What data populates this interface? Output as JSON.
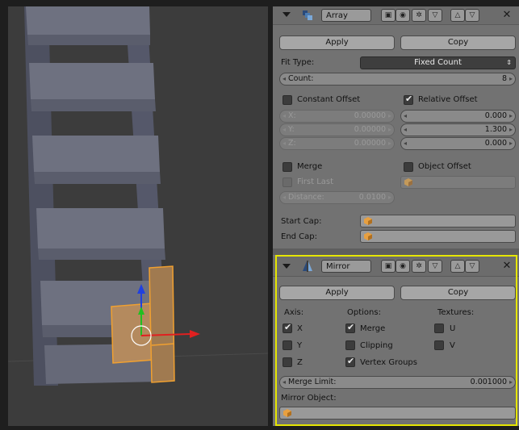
{
  "array": {
    "name": "Array",
    "apply_label": "Apply",
    "copy_label": "Copy",
    "fit_type_label": "Fit Type:",
    "fit_type_value": "Fixed Count",
    "count_label": "Count:",
    "count_value": "8",
    "constant_offset_label": "Constant Offset",
    "constant_offset_checked": false,
    "relative_offset_label": "Relative Offset",
    "relative_offset_checked": true,
    "constant": [
      {
        "label": "X:",
        "value": "0.00000"
      },
      {
        "label": "Y:",
        "value": "0.00000"
      },
      {
        "label": "Z:",
        "value": "0.00000"
      }
    ],
    "relative": [
      "0.000",
      "1.300",
      "0.000"
    ],
    "merge_label": "Merge",
    "first_last_label": "First Last",
    "distance_label": "Distance:",
    "distance_value": "0.0100",
    "object_offset_label": "Object Offset",
    "start_cap_label": "Start Cap:",
    "end_cap_label": "End Cap:"
  },
  "mirror": {
    "name": "Mirror",
    "apply_label": "Apply",
    "copy_label": "Copy",
    "axis_label": "Axis:",
    "options_label": "Options:",
    "textures_label": "Textures:",
    "x_label": "X",
    "y_label": "Y",
    "z_label": "Z",
    "merge_label": "Merge",
    "clipping_label": "Clipping",
    "vertex_groups_label": "Vertex Groups",
    "u_label": "U",
    "v_label": "V",
    "merge_limit_label": "Merge Limit:",
    "merge_limit_value": "0.001000",
    "mirror_object_label": "Mirror Object:"
  },
  "colors": {
    "selection_outline": "#e6e600",
    "mesh_selected": "#f0a030",
    "axis_x": "#e02020",
    "axis_y": "#20c020",
    "axis_z": "#2040e0"
  }
}
